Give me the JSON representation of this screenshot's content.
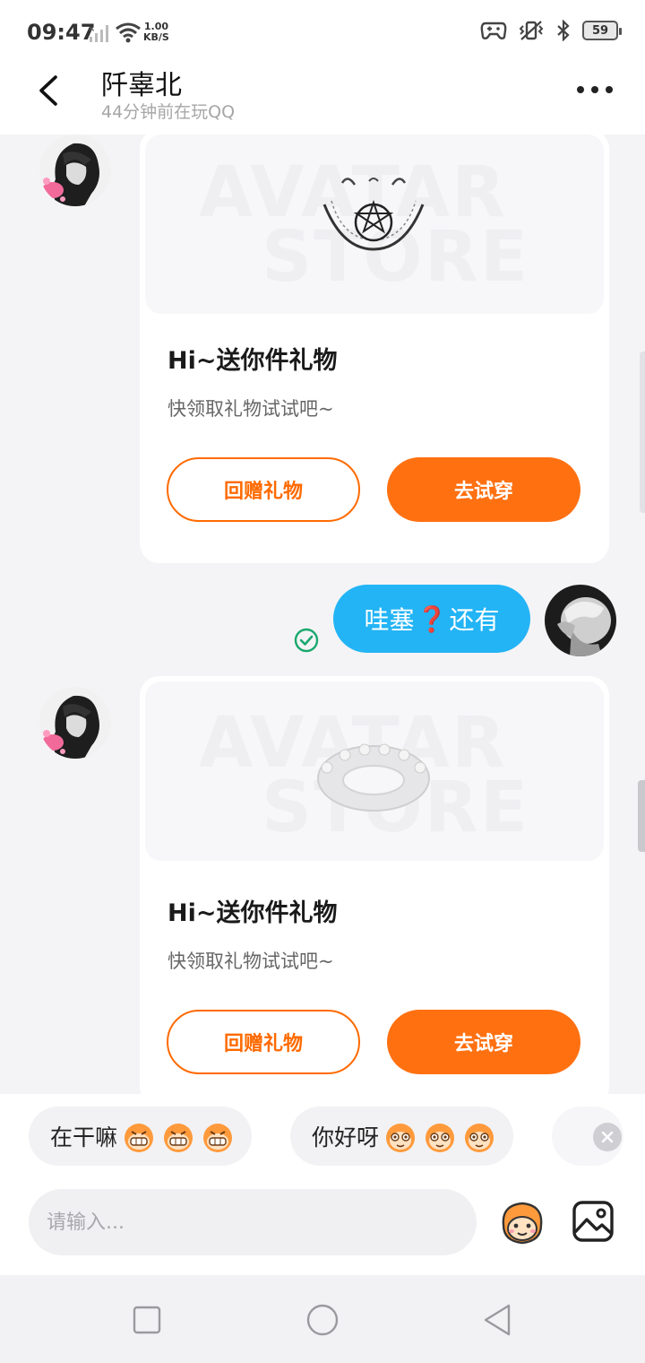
{
  "status_bar": {
    "time": "09:47",
    "speed_value": "1.00",
    "speed_unit": "KB/S",
    "battery": "59"
  },
  "header": {
    "title": "阡辜北",
    "subtitle": "44分钟前在玩QQ"
  },
  "messages": [
    {
      "type": "gift_card",
      "sender": "other",
      "watermark_line1": "AVATAR",
      "watermark_line2": "STORE",
      "title": "Hi~送你件礼物",
      "desc": "快领取礼物试试吧~",
      "btn_return": "回赠礼物",
      "btn_try": "去试穿"
    },
    {
      "type": "text",
      "sender": "me",
      "text_before": "哇塞",
      "emoji": "❓",
      "text_after": "还有"
    },
    {
      "type": "gift_card",
      "sender": "other",
      "watermark_line1": "AVATAR",
      "watermark_line2": "STORE",
      "title": "Hi~送你件礼物",
      "desc": "快领取礼物试试吧~",
      "btn_return": "回赠礼物",
      "btn_try": "去试穿"
    }
  ],
  "quick_replies": [
    {
      "label": "在干嘛"
    },
    {
      "label": "你好呀"
    }
  ],
  "input": {
    "placeholder": "请输入..."
  },
  "colors": {
    "accent_orange": "#ff7011",
    "bubble_blue": "#23b4f5",
    "read_green": "#1aa86e"
  }
}
